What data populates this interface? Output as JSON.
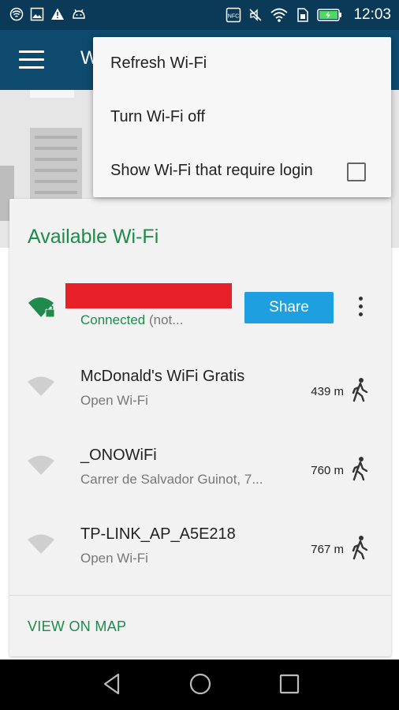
{
  "status_bar": {
    "time": "12:03",
    "left_icons": [
      "wifi-hotspot-icon",
      "image-icon",
      "warning-icon",
      "android-icon"
    ],
    "right_icons": [
      "nfc-icon",
      "mute-icon",
      "wifi-signal-icon",
      "sim-icon",
      "battery-charging-icon"
    ]
  },
  "app_bar": {
    "title": "W",
    "menu_icon": "hamburger-menu-icon",
    "color": "#0d4a6e"
  },
  "overflow_menu": {
    "items": [
      {
        "label": "Refresh Wi-Fi"
      },
      {
        "label": "Turn Wi-Fi off"
      },
      {
        "label": "Show Wi-Fi that require login",
        "checked": false
      }
    ]
  },
  "card": {
    "title": "Available Wi-Fi",
    "connected_network": {
      "status": "Connected",
      "status_rest": " (not...",
      "share_label": "Share",
      "icon": "wifi-locked-icon"
    },
    "networks": [
      {
        "name": "McDonald's WiFi Gratis",
        "subtitle": "Open Wi-Fi",
        "distance": "439 m"
      },
      {
        "name": "_ONOWiFi",
        "subtitle": "Carrer de Salvador Guinot, 7...",
        "distance": "760 m"
      },
      {
        "name": "TP-LINK_AP_A5E218",
        "subtitle": "Open Wi-Fi",
        "distance": "767 m"
      }
    ],
    "view_on_map": "VIEW ON MAP"
  },
  "colors": {
    "accent_green": "#1e8a4c",
    "share_blue": "#1ea0e0",
    "status_bar": "#0a3a57"
  },
  "nav_bar": {
    "buttons": [
      "back-icon",
      "home-icon",
      "recents-icon"
    ]
  }
}
